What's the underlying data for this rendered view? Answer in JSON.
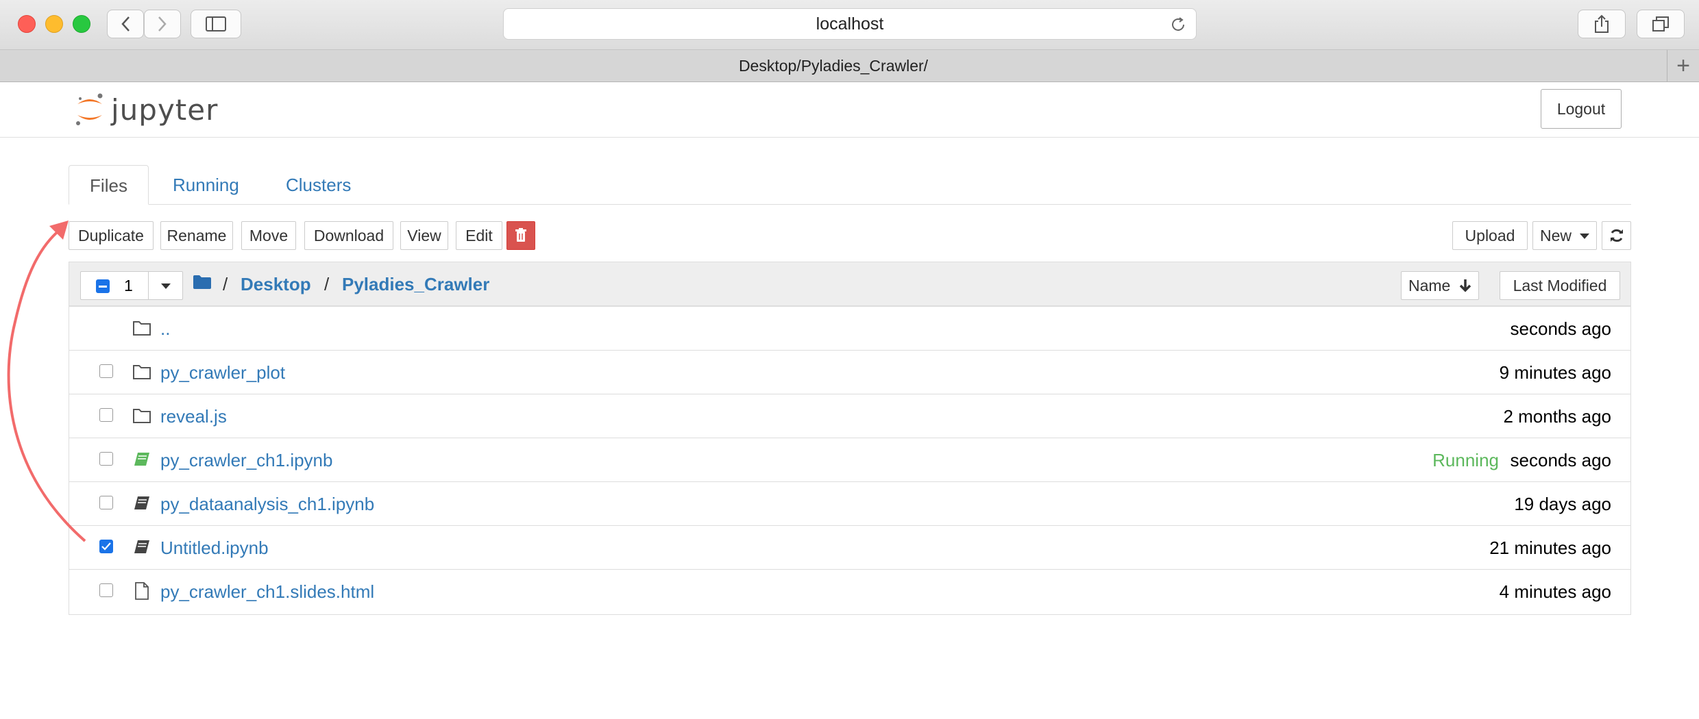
{
  "browser": {
    "url": "localhost",
    "tab_title": "Desktop/Pyladies_Crawler/",
    "new_tab_symbol": "+"
  },
  "header": {
    "logo_text": "jupyter",
    "logout_label": "Logout"
  },
  "tabs": [
    {
      "label": "Files",
      "active": true
    },
    {
      "label": "Running",
      "active": false
    },
    {
      "label": "Clusters",
      "active": false
    }
  ],
  "actions": {
    "duplicate": "Duplicate",
    "rename": "Rename",
    "move": "Move",
    "download": "Download",
    "view": "View",
    "edit": "Edit",
    "upload": "Upload",
    "new": "New"
  },
  "list_header": {
    "selected_count": "1",
    "breadcrumb": [
      "Desktop",
      "Pyladies_Crawler"
    ],
    "breadcrumb_separator": "/",
    "sort_name": "Name",
    "sort_modified": "Last Modified"
  },
  "files": [
    {
      "name": "..",
      "type": "folder",
      "modified": "seconds ago",
      "status": "",
      "checked": false,
      "has_checkbox": false
    },
    {
      "name": "py_crawler_plot",
      "type": "folder",
      "modified": "9 minutes ago",
      "status": "",
      "checked": false,
      "has_checkbox": true
    },
    {
      "name": "reveal.js",
      "type": "folder",
      "modified": "2 months ago",
      "status": "",
      "checked": false,
      "has_checkbox": true
    },
    {
      "name": "py_crawler_ch1.ipynb",
      "type": "notebook-running",
      "modified": "seconds ago",
      "status": "Running",
      "checked": false,
      "has_checkbox": true
    },
    {
      "name": "py_dataanalysis_ch1.ipynb",
      "type": "notebook",
      "modified": "19 days ago",
      "status": "",
      "checked": false,
      "has_checkbox": true
    },
    {
      "name": "Untitled.ipynb",
      "type": "notebook",
      "modified": "21 minutes ago",
      "status": "",
      "checked": true,
      "has_checkbox": true
    },
    {
      "name": "py_crawler_ch1.slides.html",
      "type": "file",
      "modified": "4 minutes ago",
      "status": "",
      "checked": false,
      "has_checkbox": true
    }
  ],
  "colors": {
    "link": "#337ab7",
    "running": "#5cb85c",
    "delete": "#d9534f",
    "annotation_arrow": "#f26b6b",
    "jupyter_orange": "#f37626"
  }
}
